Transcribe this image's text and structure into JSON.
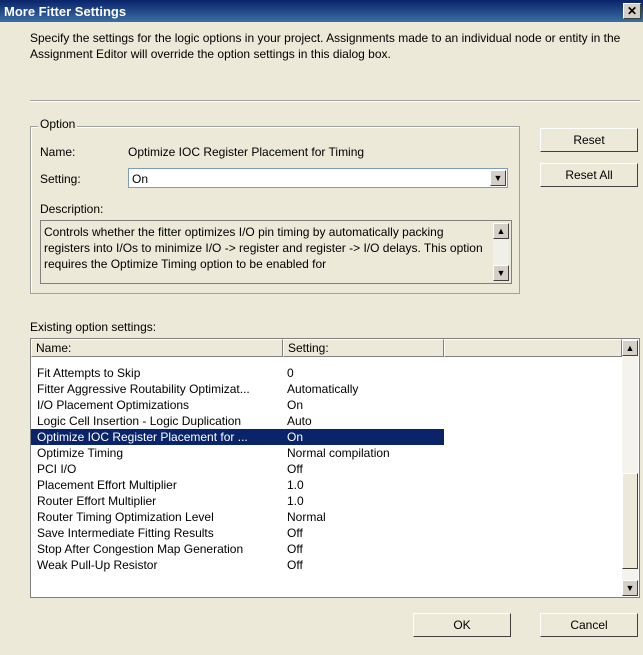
{
  "window": {
    "title": "More Fitter Settings",
    "close_glyph": "✕"
  },
  "intro": "Specify the settings for the logic options in your project.  Assignments made to an individual node or entity in the Assignment Editor will override the option settings in this dialog box.",
  "option_group": {
    "label": "Option",
    "name_label": "Name:",
    "name_value": "Optimize IOC Register Placement for Timing",
    "setting_label": "Setting:",
    "setting_value": "On",
    "description_label": "Description:",
    "description_text": "Controls whether the fitter optimizes I/O pin timing by automatically packing registers into I/Os to minimize I/O -> register and register -> I/O delays. This option requires the Optimize Timing option to be enabled for"
  },
  "buttons": {
    "reset": "Reset",
    "reset_all": "Reset All",
    "ok": "OK",
    "cancel": "Cancel"
  },
  "list": {
    "label": "Existing option settings:",
    "col_name": "Name:",
    "col_setting": "Setting:",
    "rows": [
      {
        "name": "Fit Attempts to Skip",
        "setting": "0"
      },
      {
        "name": "Fitter Aggressive Routability Optimizat...",
        "setting": "Automatically"
      },
      {
        "name": "I/O Placement Optimizations",
        "setting": "On"
      },
      {
        "name": "Logic Cell Insertion - Logic Duplication",
        "setting": "Auto"
      },
      {
        "name": "Optimize IOC Register Placement for ...",
        "setting": "On"
      },
      {
        "name": "Optimize Timing",
        "setting": "Normal compilation"
      },
      {
        "name": "PCI I/O",
        "setting": "Off"
      },
      {
        "name": "Placement Effort Multiplier",
        "setting": "1.0"
      },
      {
        "name": "Router Effort Multiplier",
        "setting": "1.0"
      },
      {
        "name": "Router Timing Optimization Level",
        "setting": "Normal"
      },
      {
        "name": "Save Intermediate Fitting Results",
        "setting": "Off"
      },
      {
        "name": "Stop After Congestion Map Generation",
        "setting": "Off"
      },
      {
        "name": "Weak Pull-Up Resistor",
        "setting": "Off"
      }
    ]
  }
}
